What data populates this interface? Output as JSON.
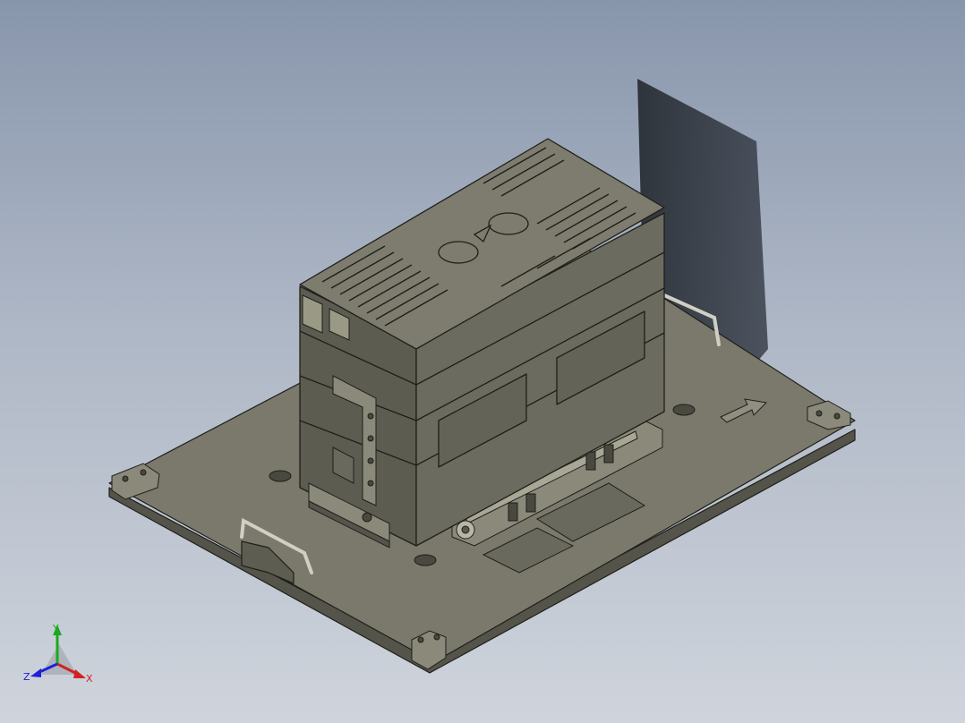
{
  "viewport": {
    "background_top": "#8896ac",
    "background_bottom": "#cfd4dc"
  },
  "model": {
    "part_color": "#6c6b5f",
    "edge_color": "#1f1f1a"
  },
  "triad": {
    "x_label": "X",
    "y_label": "Y",
    "z_label": "Z",
    "x_color": "#d42020",
    "y_color": "#1ea81e",
    "z_color": "#2020d4"
  }
}
